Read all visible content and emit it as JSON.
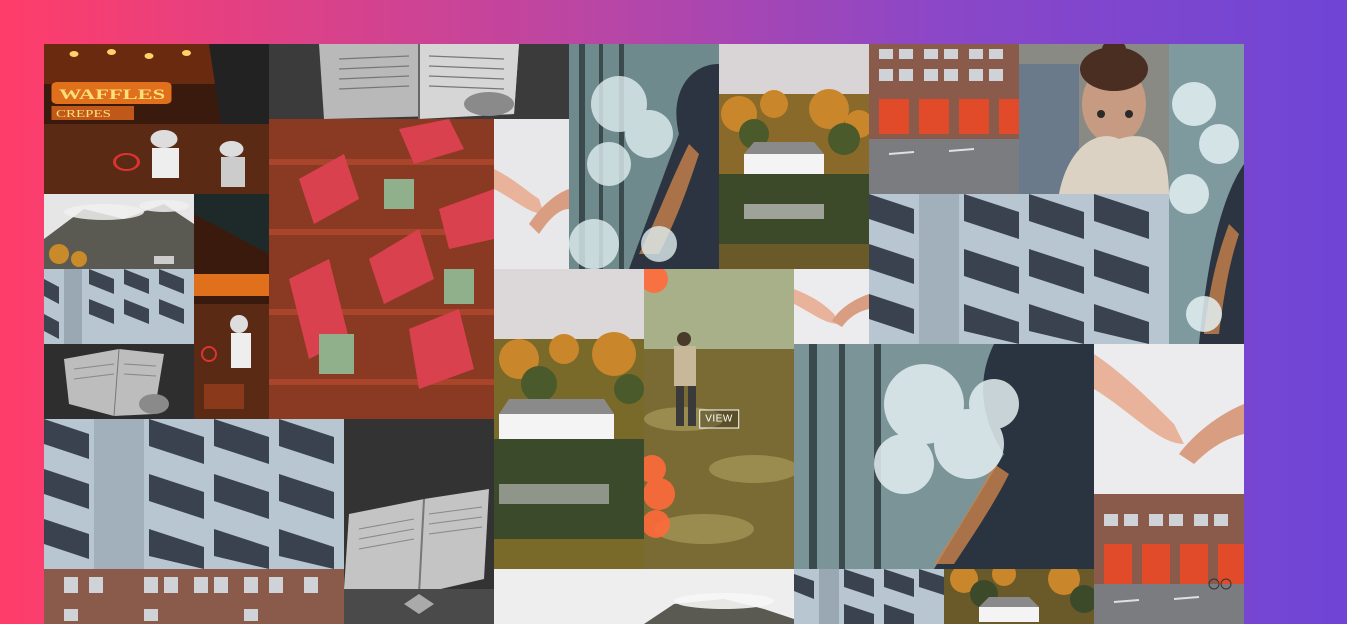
{
  "gallery": {
    "view_label": "VIEW",
    "waffles_sign_text": "WAFFLES",
    "crepes_sign_text": "CREPES",
    "tiles": [
      {
        "name": "waffles-stand-photo"
      },
      {
        "name": "open-book-photo"
      },
      {
        "name": "red-shutters-building-photo"
      },
      {
        "name": "holding-hands-photo"
      },
      {
        "name": "smoke-portrait-photo"
      },
      {
        "name": "lakeside-house-photo"
      },
      {
        "name": "fire-station-photo"
      },
      {
        "name": "woman-sweater-portrait-photo"
      },
      {
        "name": "smoke-portrait-photo"
      },
      {
        "name": "misty-mountain-photo"
      },
      {
        "name": "waffles-stand-photo"
      },
      {
        "name": "apartment-facade-photo"
      },
      {
        "name": "holding-hands-photo"
      },
      {
        "name": "apartment-facade-photo"
      },
      {
        "name": "open-book-photo"
      },
      {
        "name": "lakeside-house-photo"
      },
      {
        "name": "man-walking-field-photo"
      },
      {
        "name": "smoke-portrait-photo"
      },
      {
        "name": "holding-hands-photo"
      },
      {
        "name": "apartment-facade-photo"
      },
      {
        "name": "open-book-photo"
      },
      {
        "name": "fire-station-photo"
      },
      {
        "name": "fire-station-photo"
      },
      {
        "name": "misty-mountain-photo"
      },
      {
        "name": "apartment-facade-photo"
      },
      {
        "name": "lakeside-house-photo"
      }
    ]
  }
}
